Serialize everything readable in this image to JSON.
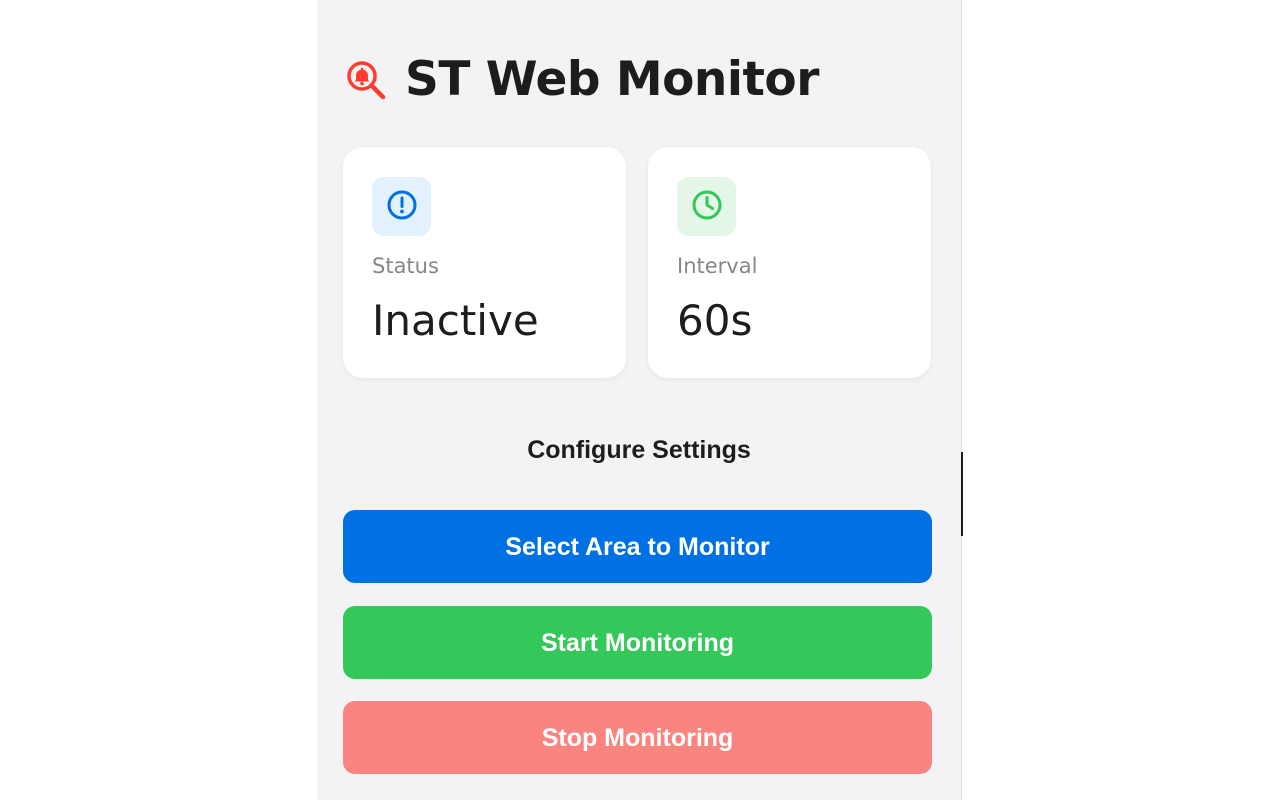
{
  "app": {
    "title": "ST Web Monitor",
    "logo_icon": "magnifier-bell-icon"
  },
  "cards": {
    "status": {
      "icon": "alert-circle-icon",
      "label": "Status",
      "value": "Inactive"
    },
    "interval": {
      "icon": "clock-icon",
      "label": "Interval",
      "value": "60s"
    }
  },
  "settings": {
    "title": "Configure Settings"
  },
  "buttons": {
    "select_area": "Select Area to Monitor",
    "start": "Start Monitoring",
    "stop": "Stop Monitoring"
  },
  "colors": {
    "primary": "#0071e3",
    "success": "#34c759",
    "danger": "#fa8580",
    "logo": "#ff3b30",
    "status_icon_bg": "#e3f0fd",
    "interval_icon_bg": "#e4f6e8"
  }
}
